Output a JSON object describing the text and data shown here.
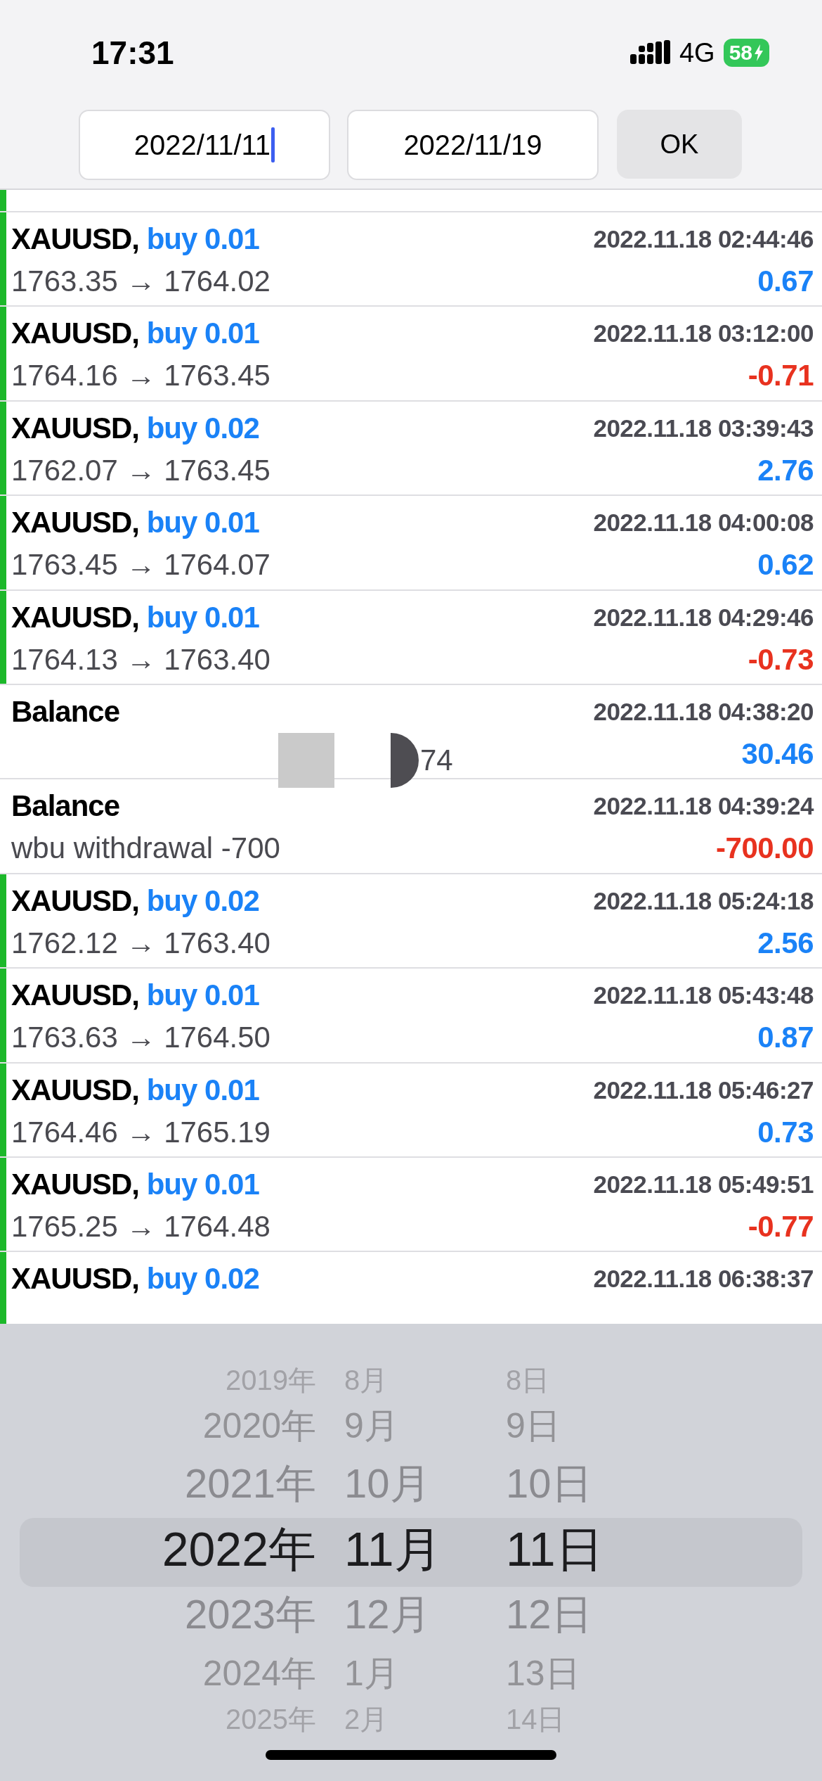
{
  "status_bar": {
    "time": "17:31",
    "network": "4G",
    "battery": "58",
    "charging": true
  },
  "date_range": {
    "from": {
      "value": "2022/11/11",
      "focused": true
    },
    "to": {
      "value": "2022/11/19",
      "focused": false
    },
    "ok_button": "OK"
  },
  "history": [
    {
      "kind": "trade",
      "symbol": "XAUUSD,",
      "side": "buy 0.01",
      "time": "2022.11.18 02:44:46",
      "prices": "1763.35 → 1764.02",
      "profit": "0.67",
      "color": "#1a82f7"
    },
    {
      "kind": "trade",
      "symbol": "XAUUSD,",
      "side": "buy 0.01",
      "time": "2022.11.18 03:12:00",
      "prices": "1764.16 → 1763.45",
      "profit": "-0.71",
      "color": "#e8321f"
    },
    {
      "kind": "trade",
      "symbol": "XAUUSD,",
      "side": "buy 0.02",
      "time": "2022.11.18 03:39:43",
      "prices": "1762.07 → 1763.45",
      "profit": "2.76",
      "color": "#1a82f7"
    },
    {
      "kind": "trade",
      "symbol": "XAUUSD,",
      "side": "buy 0.01",
      "time": "2022.11.18 04:00:08",
      "prices": "1763.45 → 1764.07",
      "profit": "0.62",
      "color": "#1a82f7"
    },
    {
      "kind": "trade",
      "symbol": "XAUUSD,",
      "side": "buy 0.01",
      "time": "2022.11.18 04:29:46",
      "prices": "1764.13 → 1763.40",
      "profit": "-0.73",
      "color": "#e8321f"
    },
    {
      "kind": "balance",
      "symbol": "Balance",
      "time": "2022.11.18 04:38:20",
      "prices": "74",
      "redacted": true,
      "profit": "30.46",
      "color": "#1a82f7"
    },
    {
      "kind": "balance",
      "symbol": "Balance",
      "time": "2022.11.18 04:39:24",
      "prices": "wbu withdrawal -700",
      "redacted": false,
      "profit": "-700.00",
      "color": "#e8321f"
    },
    {
      "kind": "trade",
      "symbol": "XAUUSD,",
      "side": "buy 0.02",
      "time": "2022.11.18 05:24:18",
      "prices": "1762.12 → 1763.40",
      "profit": "2.56",
      "color": "#1a82f7"
    },
    {
      "kind": "trade",
      "symbol": "XAUUSD,",
      "side": "buy 0.01",
      "time": "2022.11.18 05:43:48",
      "prices": "1763.63 → 1764.50",
      "profit": "0.87",
      "color": "#1a82f7"
    },
    {
      "kind": "trade",
      "symbol": "XAUUSD,",
      "side": "buy 0.01",
      "time": "2022.11.18 05:46:27",
      "prices": "1764.46 → 1765.19",
      "profit": "0.73",
      "color": "#1a82f7"
    },
    {
      "kind": "trade",
      "symbol": "XAUUSD,",
      "side": "buy 0.01",
      "time": "2022.11.18 05:49:51",
      "prices": "1765.25 → 1764.48",
      "profit": "-0.77",
      "color": "#e8321f"
    },
    {
      "kind": "trade",
      "symbol": "XAUUSD,",
      "side": "buy 0.02",
      "time": "2022.11.18 06:38:37"
    }
  ],
  "date_picker": {
    "rows": [
      {
        "year": "2019年",
        "month": "8月",
        "day": "8日",
        "selected": false
      },
      {
        "year": "2020年",
        "month": "9月",
        "day": "9日",
        "selected": false
      },
      {
        "year": "2021年",
        "month": "10月",
        "day": "10日",
        "selected": false
      },
      {
        "year": "2022年",
        "month": "11月",
        "day": "11日",
        "selected": true
      },
      {
        "year": "2023年",
        "month": "12月",
        "day": "12日",
        "selected": false
      },
      {
        "year": "2024年",
        "month": "1月",
        "day": "13日",
        "selected": false
      },
      {
        "year": "2025年",
        "month": "2月",
        "day": "14日",
        "selected": false
      }
    ]
  }
}
